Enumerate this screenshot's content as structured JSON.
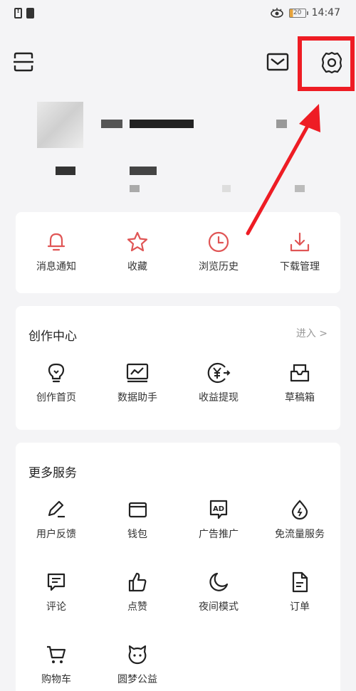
{
  "status_bar": {
    "time": "14:47",
    "battery": "20"
  },
  "quick_actions": [
    {
      "label": "消息通知",
      "icon": "bell-icon"
    },
    {
      "label": "收藏",
      "icon": "star-icon"
    },
    {
      "label": "浏览历史",
      "icon": "clock-icon"
    },
    {
      "label": "下载管理",
      "icon": "download-icon"
    }
  ],
  "creation_center": {
    "title": "创作中心",
    "enter_label": "进入 >",
    "items": [
      {
        "label": "创作首页",
        "icon": "lightbulb-icon"
      },
      {
        "label": "数据助手",
        "icon": "chart-icon"
      },
      {
        "label": "收益提现",
        "icon": "yuan-icon"
      },
      {
        "label": "草稿箱",
        "icon": "drafts-icon"
      }
    ]
  },
  "more_services": {
    "title": "更多服务",
    "items": [
      {
        "label": "用户反馈",
        "icon": "pencil-icon"
      },
      {
        "label": "钱包",
        "icon": "wallet-icon"
      },
      {
        "label": "广告推广",
        "icon": "ad-icon"
      },
      {
        "label": "免流量服务",
        "icon": "drop-icon"
      },
      {
        "label": "评论",
        "icon": "comment-icon"
      },
      {
        "label": "点赞",
        "icon": "thumbs-up-icon"
      },
      {
        "label": "夜间模式",
        "icon": "moon-icon"
      },
      {
        "label": "订单",
        "icon": "document-icon"
      },
      {
        "label": "购物车",
        "icon": "cart-icon"
      },
      {
        "label": "圆梦公益",
        "icon": "charity-icon"
      }
    ]
  },
  "colors": {
    "accent": "#e05555",
    "highlight": "#ee1c24",
    "background": "#f4f4f6"
  }
}
